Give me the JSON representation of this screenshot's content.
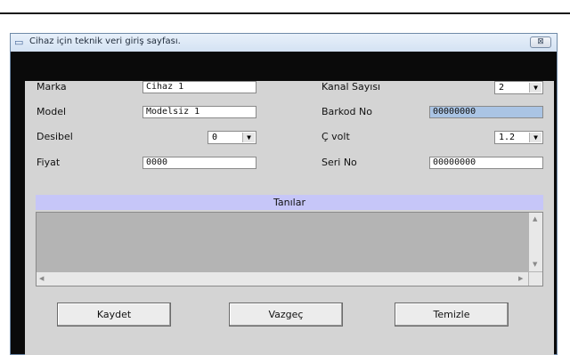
{
  "window": {
    "title": "Cihaz için teknik veri giriş sayfası.",
    "close_glyph": "⊠",
    "title_icon_glyph": "▭"
  },
  "form": {
    "marka": {
      "label": "Marka",
      "value": "Cihaz 1"
    },
    "model": {
      "label": "Model",
      "value": "Modelsiz 1"
    },
    "desibel": {
      "label": "Desibel",
      "value": "0"
    },
    "fiyat": {
      "label": "Fiyat",
      "value": "0000"
    },
    "kanal_sayisi": {
      "label": "Kanal Sayısı",
      "value": "2"
    },
    "barkod_no": {
      "label": "Barkod No",
      "value": "00000000"
    },
    "c_volt": {
      "label": "Ç volt",
      "value": "1.2"
    },
    "seri_no": {
      "label": "Seri No",
      "value": "00000000"
    }
  },
  "diagnoses": {
    "header": "Tanılar"
  },
  "buttons": {
    "save": "Kaydet",
    "cancel": "Vazgeç",
    "clear": "Temizle"
  },
  "icons": {
    "dropdown": "chevron-down-icon",
    "scroll_up": "▲",
    "scroll_down": "▼",
    "scroll_left": "◀",
    "scroll_right": "▶"
  },
  "colors": {
    "titlebar": "#d4e2f3",
    "diagnoses_header": "#c6c6f8",
    "selected_field": "#aac4e4",
    "client": "#d4d4d4"
  }
}
